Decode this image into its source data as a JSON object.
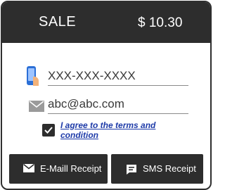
{
  "header": {
    "title": "SALE",
    "amount": "$ 10.30"
  },
  "form": {
    "phone_value": "XXX-XXX-XXXX",
    "email_value": "abc@abc.com",
    "terms_checked": true,
    "terms_label": "I agree to the terms and condition"
  },
  "buttons": {
    "email_receipt": "E-Maill Receipt",
    "sms_receipt": "SMS Receipt"
  },
  "icons": {
    "phone": "phone-icon",
    "mail": "mail-icon",
    "check": "check-icon",
    "envelope": "envelope-icon",
    "message": "message-icon"
  },
  "colors": {
    "header_bg": "#2d2d2d",
    "link": "#1d3aa8",
    "phone_blue": "#2b6fd6",
    "hand": "#f2b27a"
  }
}
